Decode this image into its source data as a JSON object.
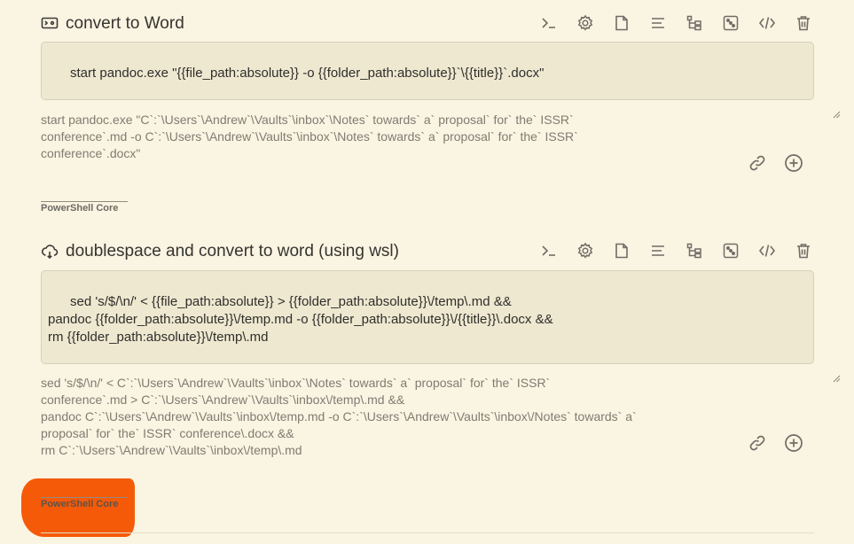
{
  "commands": [
    {
      "icon": "terminal-icon",
      "title": "convert to Word",
      "command_lines": [
        "start pandoc.exe \"{{file_path:absolute}} -o {{folder_path:absolute}}`\\{{title}}`.docx\""
      ],
      "preview_lines": [
        "start pandoc.exe \"C`:`\\Users`\\Andrew`\\Vaults`\\inbox`\\Notes` towards` a` proposal` for` the` ISSR`",
        "conference`.md -o C`:`\\Users`\\Andrew`\\Vaults`\\inbox`\\Notes` towards` a` proposal` for` the` ISSR`",
        "conference`.docx\""
      ],
      "shell": "PowerShell Core"
    },
    {
      "icon": "cloud-sync-icon",
      "title": "doublespace and convert to word (using wsl)",
      "command_lines": [
        "sed 's/$/\\n/' < {{file_path:absolute}} > {{folder_path:absolute}}\\/temp\\.md &&",
        "pandoc {{folder_path:absolute}}\\/temp.md -o {{folder_path:absolute}}\\/{{title}}\\.docx &&",
        "rm {{folder_path:absolute}}\\/temp\\.md"
      ],
      "preview_lines": [
        "sed 's/$/\\n/' < C`:`\\Users`\\Andrew`\\Vaults`\\inbox`\\Notes` towards` a` proposal` for` the` ISSR`",
        "conference`.md > C`:`\\Users`\\Andrew`\\Vaults`\\inbox\\/temp\\.md &&",
        "pandoc C`:`\\Users`\\Andrew`\\Vaults`\\inbox\\/temp.md -o C`:`\\Users`\\Andrew`\\Vaults`\\inbox\\/Notes` towards` a`",
        "proposal` for` the` ISSR` conference\\.docx &&",
        "rm C`:`\\Users`\\Andrew`\\Vaults`\\inbox\\/temp\\.md"
      ],
      "shell": "PowerShell Core"
    }
  ],
  "toolbar_icons": [
    "terminal-icon",
    "gear-icon",
    "file-icon",
    "align-left-icon",
    "tree-icon",
    "dice-icon",
    "code-icon",
    "trash-icon"
  ],
  "side_icons": [
    "link-icon",
    "plus-circle-icon"
  ],
  "colors": {
    "background": "#faf4e2",
    "input_background": "#eee8d1",
    "redaction": "#f55a09"
  }
}
